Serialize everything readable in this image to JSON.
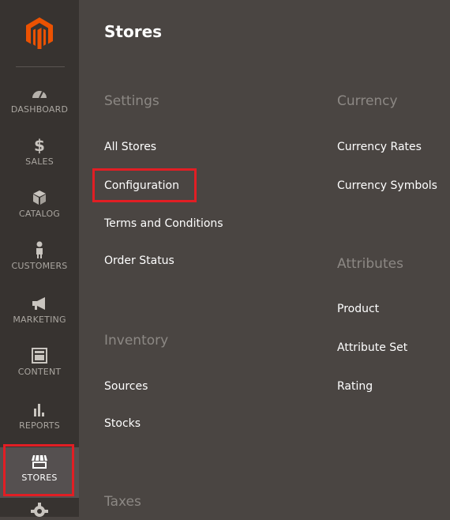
{
  "sidebar": {
    "logo_icon": "magento-logo",
    "items": [
      {
        "label": "DASHBOARD",
        "icon": "speedometer-icon"
      },
      {
        "label": "SALES",
        "icon": "dollar-icon"
      },
      {
        "label": "CATALOG",
        "icon": "cube-icon"
      },
      {
        "label": "CUSTOMERS",
        "icon": "person-icon"
      },
      {
        "label": "MARKETING",
        "icon": "megaphone-icon"
      },
      {
        "label": "CONTENT",
        "icon": "layout-icon"
      },
      {
        "label": "REPORTS",
        "icon": "bar-chart-icon"
      },
      {
        "label": "STORES",
        "icon": "storefront-icon"
      }
    ],
    "partial_item_icon": "gear-icon",
    "active_item": "STORES"
  },
  "panel": {
    "title": "Stores",
    "settings": {
      "title": "Settings",
      "links": [
        "All Stores",
        "Configuration",
        "Terms and Conditions",
        "Order Status"
      ]
    },
    "inventory": {
      "title": "Inventory",
      "links": [
        "Sources",
        "Stocks"
      ]
    },
    "taxes": {
      "title": "Taxes"
    },
    "currency": {
      "title": "Currency",
      "links": [
        "Currency Rates",
        "Currency Symbols"
      ]
    },
    "attributes": {
      "title": "Attributes",
      "links": [
        "Product",
        "Attribute Set",
        "Rating"
      ]
    }
  },
  "colors": {
    "sidebar_bg": "#373330",
    "panel_bg": "#4a4542",
    "accent_logo": "#eb5202",
    "highlight": "#e11e24"
  }
}
